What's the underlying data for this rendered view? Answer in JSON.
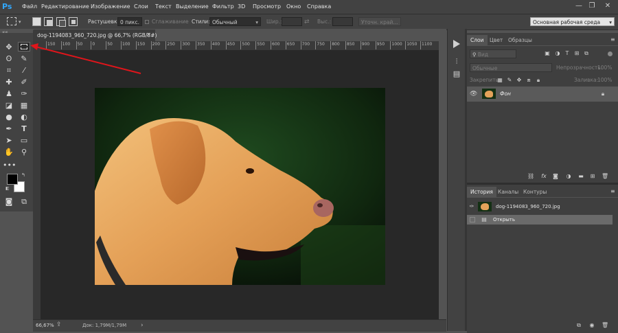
{
  "app": {
    "logo": "Ps"
  },
  "menu": [
    "Файл",
    "Редактирование",
    "Изображение",
    "Слои",
    "Текст",
    "Выделение",
    "Фильтр",
    "3D",
    "Просмотр",
    "Окно",
    "Справка"
  ],
  "window_controls": {
    "minimize": "—",
    "restore": "❐",
    "close": "✕"
  },
  "options": {
    "feather_label": "Растушевка:",
    "feather_value": "0 пикс.",
    "antialias_label": "Сглаживание",
    "style_label": "Стили:",
    "style_value": "Обычный",
    "width_label": "Шир.:",
    "height_label": "Выс.:",
    "refine_edge": "Уточн. край...",
    "workspace": "Основная рабочая среда"
  },
  "document": {
    "tab_title": "dog-1194083_960_720.jpg @ 66,7% (RGB/8#)",
    "tab_close": "×"
  },
  "ruler": {
    "labels": [
      "150",
      "100",
      "50",
      "0",
      "50",
      "100",
      "150",
      "200",
      "250",
      "300",
      "350",
      "400",
      "450",
      "500",
      "550",
      "600",
      "650",
      "700",
      "750",
      "800",
      "850",
      "900",
      "950",
      "1000",
      "1050",
      "1100"
    ]
  },
  "status": {
    "zoom": "66,67%",
    "doc_info": "Док: 1,79M/1,79M",
    "arrow": "›"
  },
  "layers_panel": {
    "tabs": [
      "Слои",
      "Цвет",
      "Образцы"
    ],
    "search_placeholder": "Вид",
    "blend_mode": "Обычные",
    "opacity_label": "Непрозрачность:",
    "opacity_value": "100%",
    "lock_label": "Закрепить:",
    "fill_label": "Заливка:",
    "fill_value": "100%",
    "layer_name": "Фон"
  },
  "history_panel": {
    "tabs": [
      "История",
      "Каналы",
      "Контуры"
    ],
    "snapshot_name": "dog-1194083_960_720.jpg",
    "step_open": "Открыть"
  },
  "colors": {
    "foreground": "#000000",
    "background": "#ffffff",
    "annotation_arrow": "#e0151b"
  }
}
